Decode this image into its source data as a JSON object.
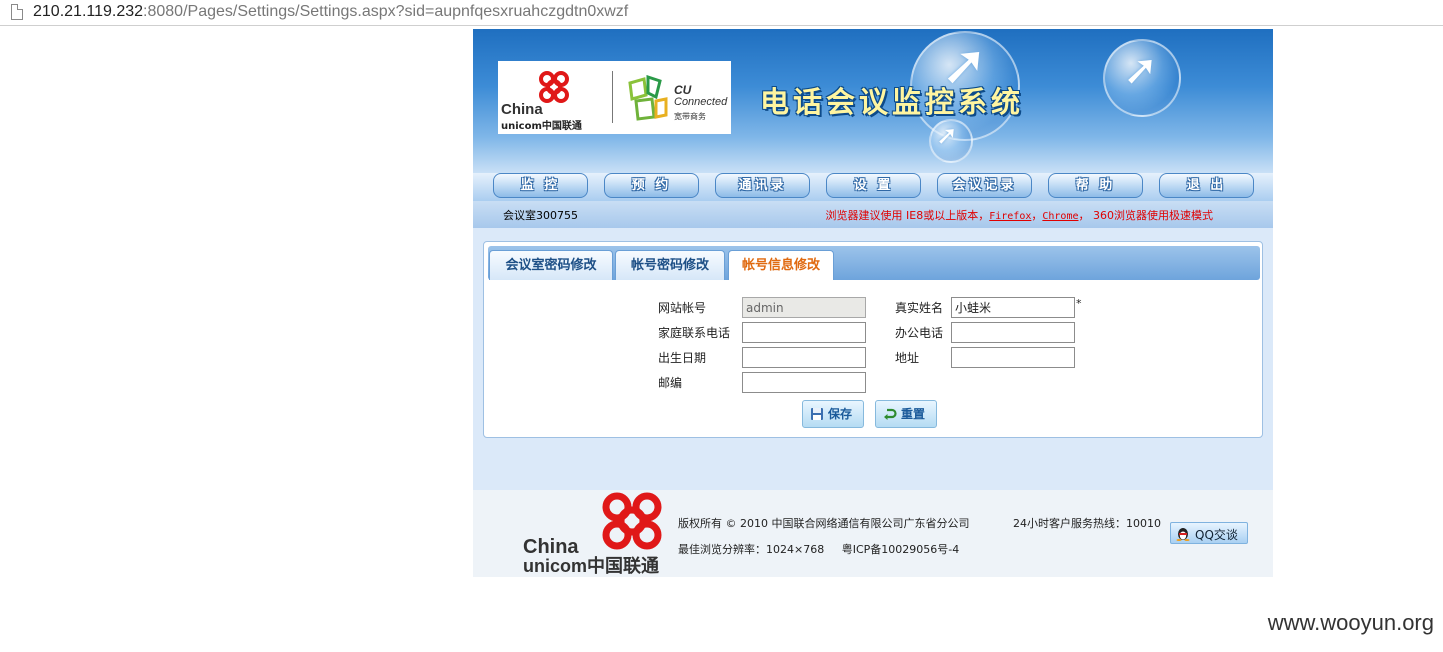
{
  "browser": {
    "url_host": "210.21.119.232",
    "url_rest": ":8080/Pages/Settings/Settings.aspx?sid=aupnfqesxruahczgdtn0xwzf"
  },
  "banner": {
    "logo_china": "China",
    "logo_unicom": "unicom中国联通",
    "cu_line1": "CU",
    "cu_line2": "Connected",
    "cu_cn": "宽带商务",
    "system_title": "电话会议监控系统"
  },
  "nav": {
    "items": [
      {
        "label": "监 控"
      },
      {
        "label": "预 约"
      },
      {
        "label": "通讯录"
      },
      {
        "label": "设 置"
      },
      {
        "label": "会议记录"
      },
      {
        "label": "帮 助"
      },
      {
        "label": "退 出"
      }
    ]
  },
  "info": {
    "room": "会议室300755",
    "tip_prefix": "浏览器建议使用 IE8或以上版本，",
    "tip_firefox": "Firefox",
    "tip_sep": "，",
    "tip_chrome": "Chrome",
    "tip_suffix": "， 360浏览器使用极速模式"
  },
  "tabs": [
    {
      "label": "会议室密码修改",
      "active": false
    },
    {
      "label": "帐号密码修改",
      "active": false
    },
    {
      "label": "帐号信息修改",
      "active": true
    }
  ],
  "form": {
    "site_account_label": "网站帐号",
    "site_account_value": "admin",
    "real_name_label": "真实姓名",
    "real_name_value": "小蛙米",
    "required_mark": "*",
    "home_phone_label": "家庭联系电话",
    "home_phone_value": "",
    "office_phone_label": "办公电话",
    "office_phone_value": "",
    "birth_date_label": "出生日期",
    "birth_date_value": "",
    "address_label": "地址",
    "address_value": "",
    "postcode_label": "邮编",
    "postcode_value": ""
  },
  "actions": {
    "save_label": "保存",
    "reset_label": "重置"
  },
  "footer": {
    "china": "China",
    "unicom": "unicom中国联通",
    "copyright": "版权所有 © 2010 中国联合网络通信有限公司广东省分公司",
    "hotline": "24小时客户服务热线：10010",
    "resolution": "最佳浏览分辨率：1024×768",
    "icp": "粤ICP备10029056号-4",
    "qq_label": "QQ交谈"
  },
  "watermark": "www.wooyun.org",
  "colors": {
    "accent": "#3d8cd6",
    "active_tab_text": "#e06a10",
    "warning_text": "#e00000"
  }
}
